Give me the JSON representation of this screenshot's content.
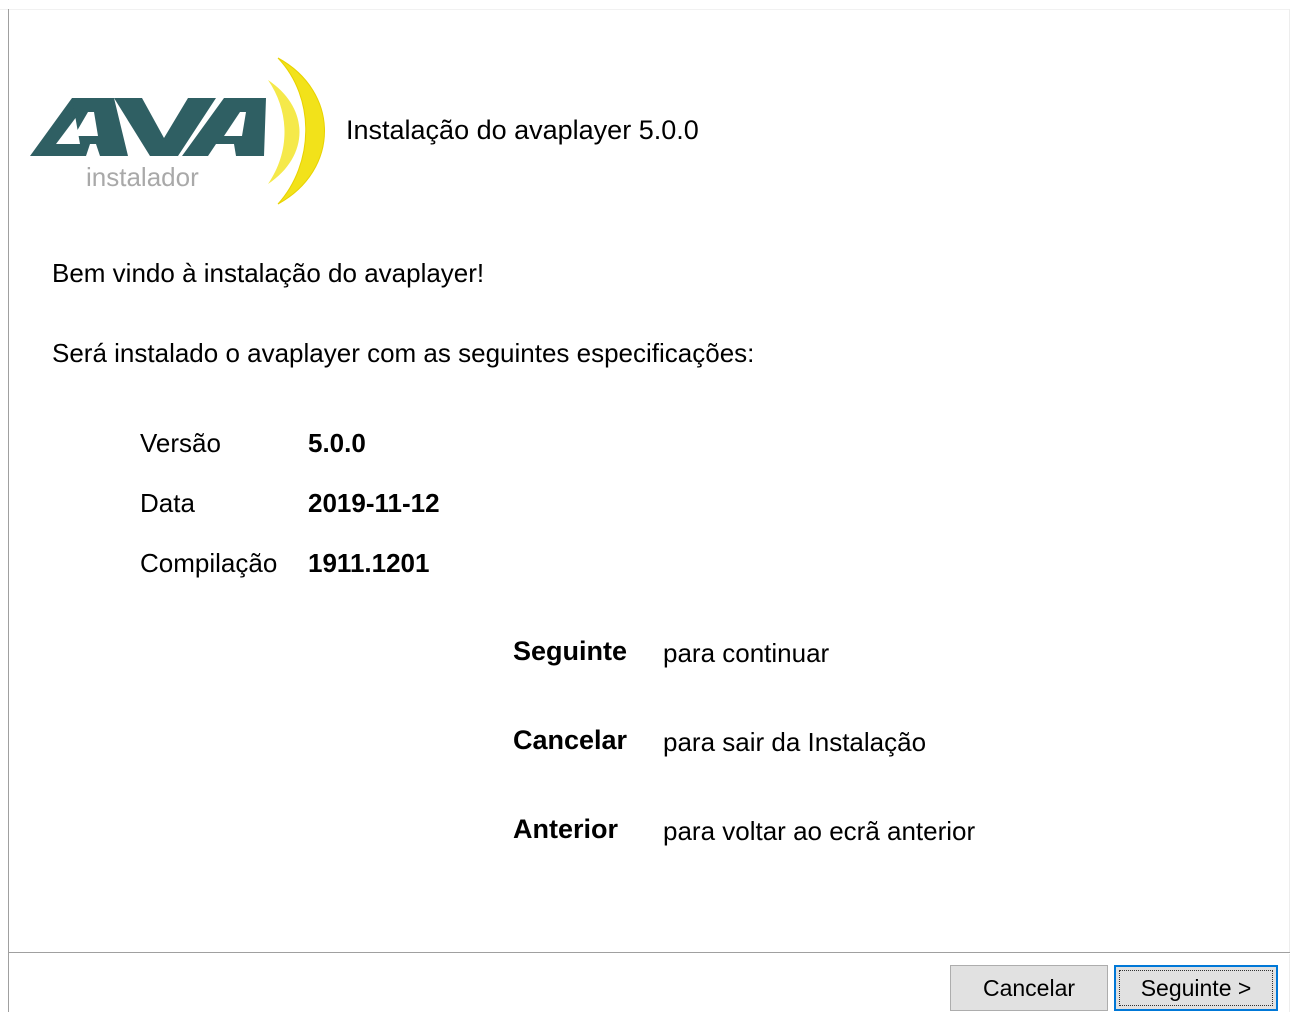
{
  "header": {
    "logo_text": "AVA",
    "logo_subtext": "instalador",
    "title": "Instalação do avaplayer 5.0.0"
  },
  "intro": {
    "welcome": "Bem vindo à instalação do avaplayer!",
    "spec_intro": "Será instalado o avaplayer com as seguintes especificações:"
  },
  "specs": [
    {
      "label": "Versão",
      "value": "5.0.0"
    },
    {
      "label": "Data",
      "value": "2019-11-12"
    },
    {
      "label": "Compilação",
      "value": "1911.1201"
    }
  ],
  "hints": [
    {
      "key": "Seguinte",
      "text": "para continuar"
    },
    {
      "key": "Cancelar",
      "text": "para sair da Instalação"
    },
    {
      "key": "Anterior",
      "text": "para voltar ao ecrã anterior"
    }
  ],
  "buttons": {
    "cancel_label": "Cancelar",
    "next_label": "Seguinte >"
  },
  "colors": {
    "logo_teal": "#2f5f63",
    "logo_yellow": "#f2e21a",
    "logo_subtext": "#a9a9a9",
    "focus_border": "#0078d7"
  },
  "icons": {
    "logo": "ava-installer-logo"
  }
}
